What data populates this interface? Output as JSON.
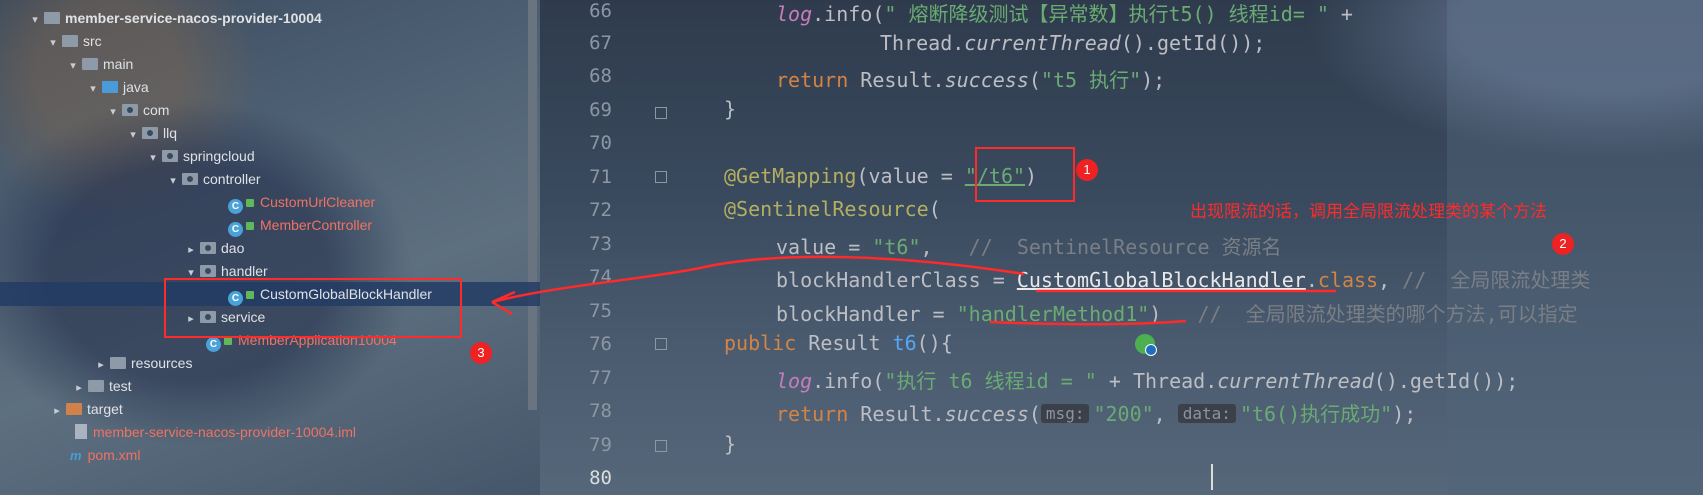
{
  "project_tree": {
    "rows": [
      {
        "label": "member-service-nacos-provider-10004",
        "bold": true
      },
      {
        "label": "src"
      },
      {
        "label": "main"
      },
      {
        "label": "java"
      },
      {
        "label": "com"
      },
      {
        "label": "llq"
      },
      {
        "label": "springcloud"
      },
      {
        "label": "controller"
      },
      {
        "label": "CustomUrlCleaner"
      },
      {
        "label": "MemberController"
      },
      {
        "label": "dao"
      },
      {
        "label": "handler"
      },
      {
        "label": "CustomGlobalBlockHandler"
      },
      {
        "label": "service"
      },
      {
        "label": "MemberApplication10004"
      },
      {
        "label": "resources"
      },
      {
        "label": "test"
      },
      {
        "label": "target"
      },
      {
        "label": "member-service-nacos-provider-10004.iml"
      },
      {
        "label": "pom.xml"
      }
    ]
  },
  "editor": {
    "line_numbers": [
      "66",
      "67",
      "68",
      "69",
      "70",
      "71",
      "72",
      "73",
      "74",
      "75",
      "76",
      "77",
      "78",
      "79",
      "80"
    ],
    "current_line": "80",
    "lines": {
      "l66": {
        "p1": "log",
        "p2": ".info(",
        "p3": "\" 熔断降级测试【异常数】执行t5() 线程id= \"",
        "p4": " +"
      },
      "l67": {
        "p1": "Thread.",
        "p2": "currentThread",
        "p3": "().getId());"
      },
      "l68": {
        "p1": "return",
        "p2": " Result.",
        "p3": "success",
        "p4": "(",
        "p5": "\"t5 执行\"",
        "p6": ");"
      },
      "l69": {
        "p1": "}"
      },
      "l71": {
        "p1": "@GetMapping",
        "p2": "(value = ",
        "p3": "\"/t6\"",
        "p4": ")"
      },
      "l72": {
        "p1": "@SentinelResource",
        "p2": "("
      },
      "l73": {
        "p1": "value = ",
        "p2": "\"t6\"",
        "p3": ",   ",
        "p4": "//  SentinelResource 资源名"
      },
      "l74": {
        "p1": "blockHandlerClass = ",
        "p2": "CustomGlobalBlockHandler",
        "p3": ".",
        "p4": "class",
        "p5": ", ",
        "p6": "//  全局限流处理类"
      },
      "l75": {
        "p1": "blockHandler = ",
        "p2": "\"handlerMethod1\"",
        "p3": ")   ",
        "p4": "//  全局限流处理类的哪个方法,可以指定"
      },
      "l76": {
        "p1": "public",
        "p2": " Result ",
        "p3": "t6",
        "p4": "(){"
      },
      "l77": {
        "p1": "log",
        "p2": ".info(",
        "p3": "\"执行 t6 线程id = \"",
        "p4": " + Thread.",
        "p5": "currentThread",
        "p6": "().getId());"
      },
      "l78": {
        "p1": "return",
        "p2": " Result.",
        "p3": "success",
        "p4": "(",
        "hint1": "msg:",
        "p5": "\"200\"",
        "p6": ", ",
        "hint2": "data:",
        "p7": "\"t6()执行成功\"",
        "p8": ");"
      },
      "l79": {
        "p1": "}"
      }
    }
  },
  "annotations": {
    "badge1": "1",
    "badge2": "2",
    "badge3": "3",
    "note": "出现限流的话，调用全局限流处理类的某个方法"
  },
  "colors": {
    "annotation_red": "#ff2a2a",
    "keyword": "#d28445",
    "string": "#6aab73",
    "annotation": "#b3ae60",
    "field": "#c77dbb",
    "method": "#56a8f5",
    "comment": "#7a7e85"
  }
}
